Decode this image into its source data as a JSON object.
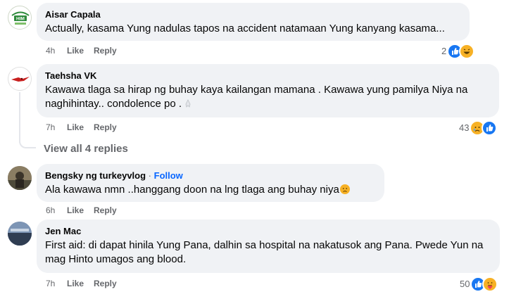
{
  "comments": [
    {
      "author": "Aisar Capala",
      "text": "Actually, kasama Yung nadulas tapos na accident natamaan Yung kanyang kasama...",
      "time": "4h",
      "like": "Like",
      "reply": "Reply",
      "reaction_count": "2",
      "reactions": [
        "like-reaction-icon",
        "haha-reaction-icon"
      ],
      "avatar_text": "HIM"
    },
    {
      "author": "Taehsha VK",
      "text": "Kawawa tlaga sa hirap ng buhay kaya kailangan mamana . Kawawa yung pamilya Niya na naghihintay.. condolence po .",
      "time": "7h",
      "like": "Like",
      "reply": "Reply",
      "reaction_count": "43",
      "reactions": [
        "sad-reaction-icon",
        "like-reaction-icon"
      ],
      "view_replies": "View all 4 replies"
    },
    {
      "author": "Bengsky ng turkeyvlog",
      "separator": "·",
      "follow": "Follow",
      "text": "Ala kawawa nmn ..hanggang doon na lng tlaga ang buhay niya",
      "time": "6h",
      "like": "Like",
      "reply": "Reply"
    },
    {
      "author": "Jen Mac",
      "text": "First aid: di dapat hinila Yung Pana, dalhin sa hospital na nakatusok ang Pana. Pwede Yun na mag Hinto umagos ang blood.",
      "time": "7h",
      "like": "Like",
      "reply": "Reply",
      "reaction_count": "50",
      "reactions": [
        "like-reaction-icon",
        "care-reaction-icon"
      ]
    }
  ],
  "colors": {
    "bubble": "#f0f2f5",
    "meta": "#65676b",
    "follow": "#0866ff",
    "like_reaction": "#1877f2",
    "emoji": "#f7b125"
  }
}
